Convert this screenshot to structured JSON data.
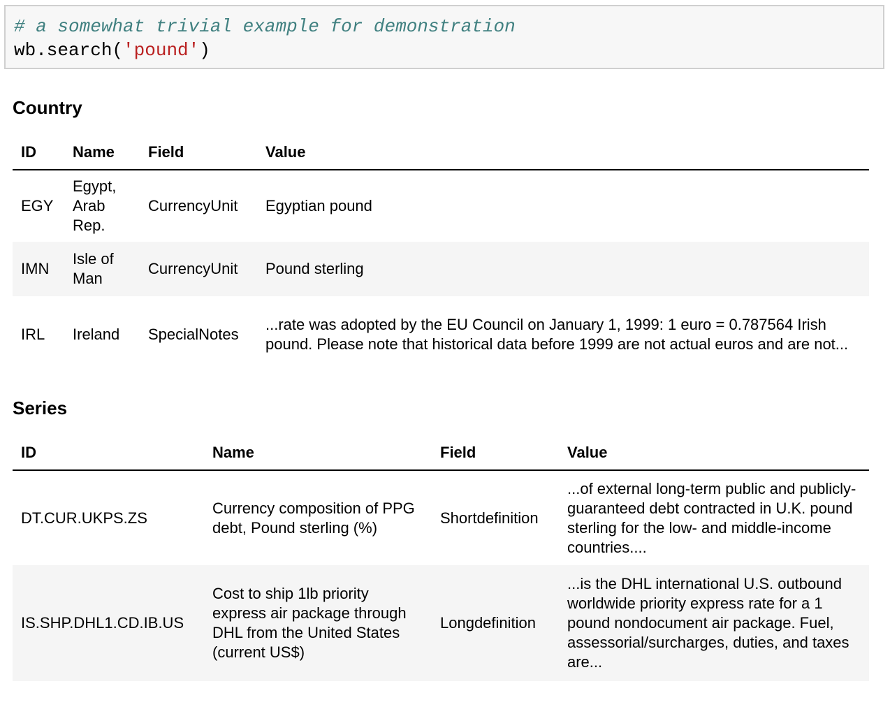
{
  "code": {
    "comment": "# a somewhat trivial example for demonstration",
    "call_prefix": "wb.search(",
    "call_arg": "'pound'",
    "call_suffix": ")"
  },
  "country": {
    "title": "Country",
    "headers": [
      "ID",
      "Name",
      "Field",
      "Value"
    ],
    "rows": [
      [
        "EGY",
        "Egypt, Arab Rep.",
        "CurrencyUnit",
        "Egyptian pound"
      ],
      [
        "IMN",
        "Isle of Man",
        "CurrencyUnit",
        "Pound sterling"
      ],
      [
        "IRL",
        "Ireland",
        "SpecialNotes",
        "...rate was adopted by the EU Council on January 1, 1999: 1 euro = 0.787564 Irish pound. Please note that historical data before 1999 are not actual euros and are not..."
      ]
    ]
  },
  "series": {
    "title": "Series",
    "headers": [
      "ID",
      "Name",
      "Field",
      "Value"
    ],
    "rows": [
      [
        "DT.CUR.UKPS.ZS",
        "Currency composition of PPG debt, Pound sterling (%)",
        "Shortdefinition",
        "...of external long-term public and publicly-guaranteed debt contracted in U.K. pound sterling for the low- and middle-income countries...."
      ],
      [
        "IS.SHP.DHL1.CD.IB.US",
        "Cost to ship 1lb priority express air package through DHL from the United States (current US$)",
        "Longdefinition",
        "...is the DHL international U.S. outbound worldwide priority express rate for a 1 pound nondocument air package. Fuel, assessorial/surcharges, duties, and taxes are..."
      ]
    ]
  }
}
